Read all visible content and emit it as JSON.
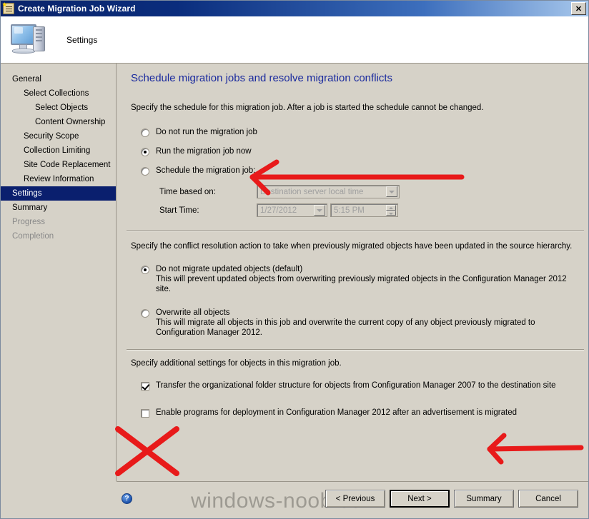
{
  "window": {
    "title": "Create Migration Job Wizard",
    "close_label": "✕",
    "icon": "wizard-list-icon"
  },
  "header": {
    "label": "Settings",
    "icon": "computer-icon"
  },
  "sidebar": {
    "items": [
      {
        "label": "General",
        "indent": 0,
        "state": "normal"
      },
      {
        "label": "Select Collections",
        "indent": 1,
        "state": "normal"
      },
      {
        "label": "Select Objects",
        "indent": 2,
        "state": "normal"
      },
      {
        "label": "Content Ownership",
        "indent": 2,
        "state": "normal"
      },
      {
        "label": "Security Scope",
        "indent": 1,
        "state": "normal"
      },
      {
        "label": "Collection Limiting",
        "indent": 1,
        "state": "normal"
      },
      {
        "label": "Site Code Replacement",
        "indent": 1,
        "state": "normal"
      },
      {
        "label": "Review Information",
        "indent": 1,
        "state": "normal"
      },
      {
        "label": "Settings",
        "indent": 0,
        "state": "selected"
      },
      {
        "label": "Summary",
        "indent": 0,
        "state": "normal"
      },
      {
        "label": "Progress",
        "indent": 0,
        "state": "disabled"
      },
      {
        "label": "Completion",
        "indent": 0,
        "state": "disabled"
      }
    ]
  },
  "main": {
    "page_title": "Schedule migration jobs and resolve migration conflicts",
    "schedule": {
      "intro": "Specify the schedule for this migration job. After a job is started the schedule cannot be changed.",
      "options": [
        {
          "label": "Do not run the migration job",
          "checked": false
        },
        {
          "label": "Run the migration job now",
          "checked": true
        },
        {
          "label": "Schedule the migration job:",
          "checked": false
        }
      ],
      "time_based_label": "Time based on:",
      "time_based_value": "Destination server local time",
      "start_time_label": "Start Time:",
      "start_date_value": "1/27/2012",
      "start_clock_value": "5:15 PM"
    },
    "conflict": {
      "intro": "Specify the conflict resolution action to take when previously migrated objects have been updated in the source hierarchy.",
      "options": [
        {
          "label": "Do not migrate updated objects  (default)",
          "description": "This will prevent updated objects from overwriting previously migrated objects in the Configuration Manager 2012 site.",
          "checked": true
        },
        {
          "label": "Overwrite all objects",
          "description": "This will migrate all objects in this job and overwrite the current copy of any object previously migrated to Configuration Manager 2012.",
          "checked": false
        }
      ]
    },
    "additional": {
      "intro": "Specify additional settings for objects in this migration job.",
      "checkboxes": [
        {
          "label": "Transfer the organizational folder structure for objects from Configuration Manager 2007 to the destination site",
          "checked": true
        },
        {
          "label": "Enable programs for deployment in Configuration Manager 2012 after an advertisement is migrated",
          "checked": false
        }
      ]
    }
  },
  "footer": {
    "help_glyph": "?",
    "watermark": "windows-noob.com",
    "buttons": [
      {
        "label": "< Previous",
        "default": false
      },
      {
        "label": "Next >",
        "default": true
      },
      {
        "label": "Summary",
        "default": false
      },
      {
        "label": "Cancel",
        "default": false
      }
    ]
  },
  "annotations": {
    "color": "#e81a1a",
    "items": [
      {
        "kind": "arrow-left",
        "target": "run-the-migration-job-now"
      },
      {
        "kind": "arrow-left",
        "target": "enable-programs-checkbox"
      },
      {
        "kind": "cross",
        "target": "enable-programs-checkbox"
      }
    ]
  }
}
